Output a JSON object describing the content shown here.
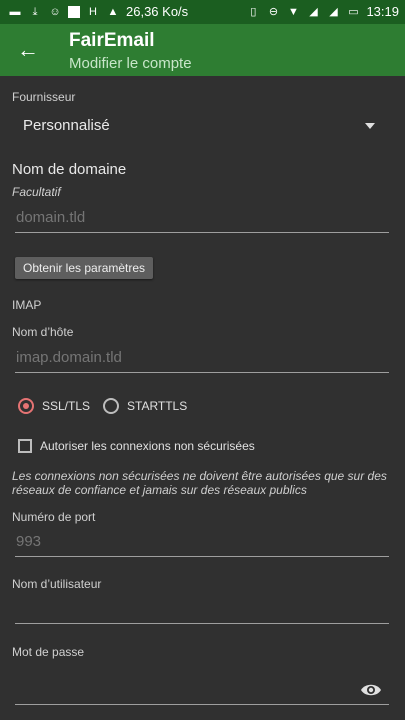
{
  "statusbar": {
    "speed": "26,36 Ko/s",
    "time": "13:19"
  },
  "appbar": {
    "title": "FairEmail",
    "subtitle": "Modifier le compte"
  },
  "provider": {
    "label": "Fournisseur",
    "value": "Personnalisé"
  },
  "domain": {
    "label": "Nom de domaine",
    "hint": "Facultatif",
    "placeholder": "domain.tld",
    "button": "Obtenir les paramètres"
  },
  "imap": {
    "section": "IMAP",
    "host_label": "Nom d’hôte",
    "host_placeholder": "imap.domain.tld",
    "ssl_label": "SSL/TLS",
    "starttls_label": "STARTTLS",
    "insecure_label": "Autoriser les connexions non sécurisées",
    "insecure_hint": "Les connexions non sécurisées ne doivent être autorisées que sur des réseaux de confiance et jamais sur des réseaux publics",
    "port_label": "Numéro de port",
    "port_placeholder": "993",
    "user_label": "Nom d’utilisateur",
    "password_label": "Mot de passe"
  },
  "colors": {
    "appbar": "#2e7d32",
    "statusbar": "#1b5e20",
    "background": "#303030",
    "accent": "#e57373"
  }
}
